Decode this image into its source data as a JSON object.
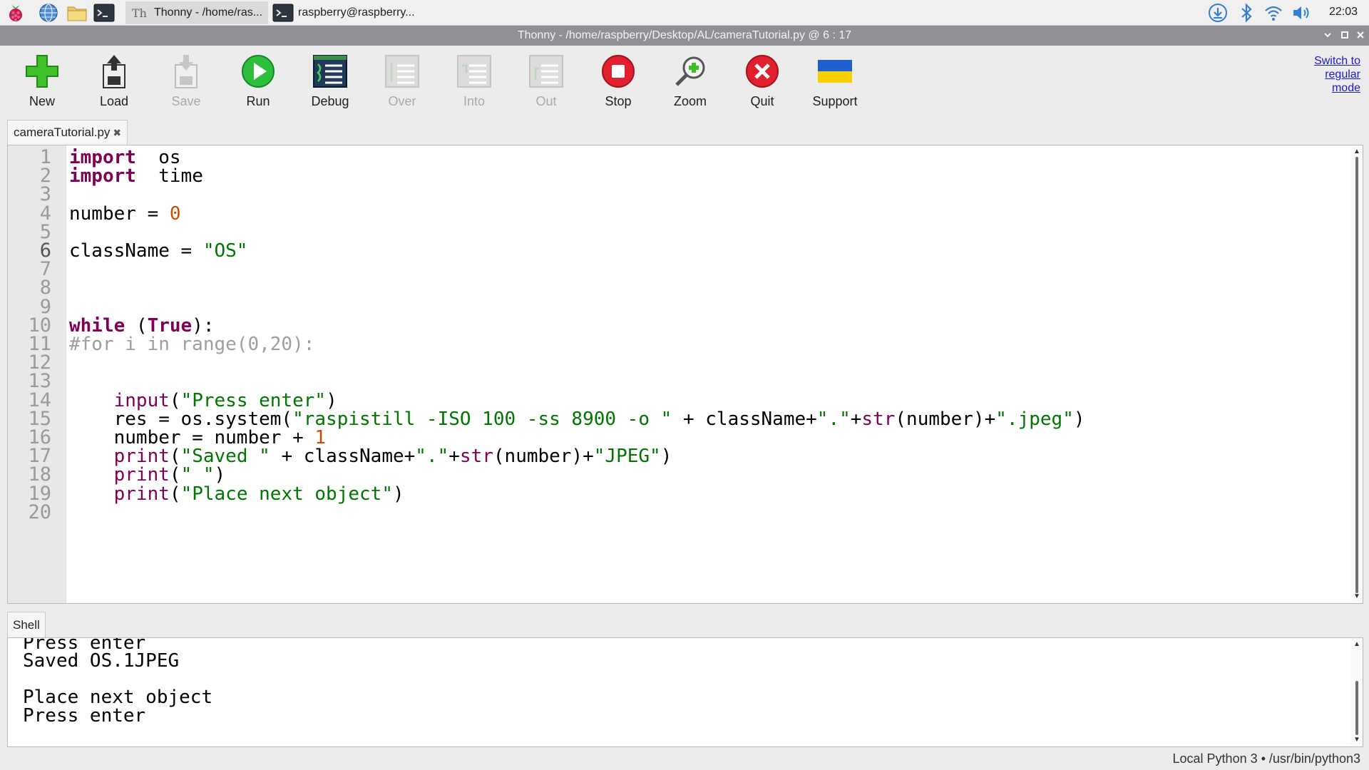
{
  "taskbar": {
    "launchers": [
      "raspberry-menu-icon",
      "web-browser-icon",
      "file-manager-icon",
      "terminal-icon"
    ],
    "tasks": [
      {
        "label": "Thonny  -  /home/ras...",
        "icon": "thonny-icon"
      },
      {
        "label": "raspberry@raspberry...",
        "icon": "terminal-icon"
      }
    ],
    "tray": [
      "update-icon",
      "bluetooth-icon",
      "wifi-icon",
      "volume-icon"
    ],
    "clock": "22:03"
  },
  "window": {
    "title": "Thonny  -  /home/raspberry/Desktop/AL/cameraTutorial.py  @  6 : 17"
  },
  "toolbar": {
    "buttons": [
      {
        "label": "New",
        "enabled": true
      },
      {
        "label": "Load",
        "enabled": true
      },
      {
        "label": "Save",
        "enabled": false
      },
      {
        "label": "Run",
        "enabled": true
      },
      {
        "label": "Debug",
        "enabled": true
      },
      {
        "label": "Over",
        "enabled": false
      },
      {
        "label": "Into",
        "enabled": false
      },
      {
        "label": "Out",
        "enabled": false
      },
      {
        "label": "Stop",
        "enabled": true
      },
      {
        "label": "Zoom",
        "enabled": true
      },
      {
        "label": "Quit",
        "enabled": true
      },
      {
        "label": "Support",
        "enabled": true
      }
    ],
    "switch_mode": [
      "Switch to",
      "regular",
      "mode"
    ]
  },
  "editor": {
    "tab_label": "cameraTutorial.py",
    "current_line": 6,
    "line_numbers": [
      "1",
      "2",
      "3",
      "4",
      "5",
      "6",
      "7",
      "8",
      "9",
      "10",
      "11",
      "12",
      "13",
      "14",
      "15",
      "16",
      "17",
      "18",
      "19",
      "20"
    ],
    "lines": [
      [
        [
          "kw",
          "import"
        ],
        [
          "",
          "  os"
        ]
      ],
      [
        [
          "kw",
          "import"
        ],
        [
          "",
          "  time"
        ]
      ],
      [],
      [
        [
          "",
          "number = "
        ],
        [
          "nu",
          "0"
        ]
      ],
      [],
      [
        [
          "",
          "className = "
        ],
        [
          "st",
          "\"OS\""
        ]
      ],
      [],
      [],
      [],
      [
        [
          "kw",
          "while"
        ],
        [
          "",
          " ("
        ],
        [
          "kw",
          "True"
        ],
        [
          "",
          "):"
        ]
      ],
      [
        [
          "cm",
          "#for i in range(0,20):"
        ]
      ],
      [],
      [],
      [
        [
          "",
          "    "
        ],
        [
          "bi",
          "input"
        ],
        [
          "",
          "("
        ],
        [
          "st",
          "\"Press enter\""
        ],
        [
          "",
          ")"
        ]
      ],
      [
        [
          "",
          "    res = os.system("
        ],
        [
          "st",
          "\"raspistill -ISO 100 -ss 8900 -o \""
        ],
        [
          "",
          " + className+"
        ],
        [
          "st",
          "\".\""
        ],
        [
          "",
          "+"
        ],
        [
          "bi",
          "str"
        ],
        [
          "",
          "(number)+"
        ],
        [
          "st",
          "\".jpeg\""
        ],
        [
          "",
          ")"
        ]
      ],
      [
        [
          "",
          "    number = number + "
        ],
        [
          "nu",
          "1"
        ]
      ],
      [
        [
          "",
          "    "
        ],
        [
          "bi",
          "print"
        ],
        [
          "",
          "("
        ],
        [
          "st",
          "\"Saved \""
        ],
        [
          "",
          " + className+"
        ],
        [
          "st",
          "\".\""
        ],
        [
          "",
          "+"
        ],
        [
          "bi",
          "str"
        ],
        [
          "",
          "(number)+"
        ],
        [
          "st",
          "\"JPEG\""
        ],
        [
          "",
          ")"
        ]
      ],
      [
        [
          "",
          "    "
        ],
        [
          "bi",
          "print"
        ],
        [
          "",
          "("
        ],
        [
          "st",
          "\" \""
        ],
        [
          "",
          ")"
        ]
      ],
      [
        [
          "",
          "    "
        ],
        [
          "bi",
          "print"
        ],
        [
          "",
          "("
        ],
        [
          "st",
          "\"Place next object\""
        ],
        [
          "",
          ")"
        ]
      ],
      []
    ]
  },
  "shell": {
    "tab_label": "Shell",
    "lines": [
      "Press enter",
      "Saved OS.1JPEG",
      "",
      "Place next object",
      "Press enter"
    ]
  },
  "statusbar": {
    "text": "Local Python 3  •  /usr/bin/python3"
  }
}
